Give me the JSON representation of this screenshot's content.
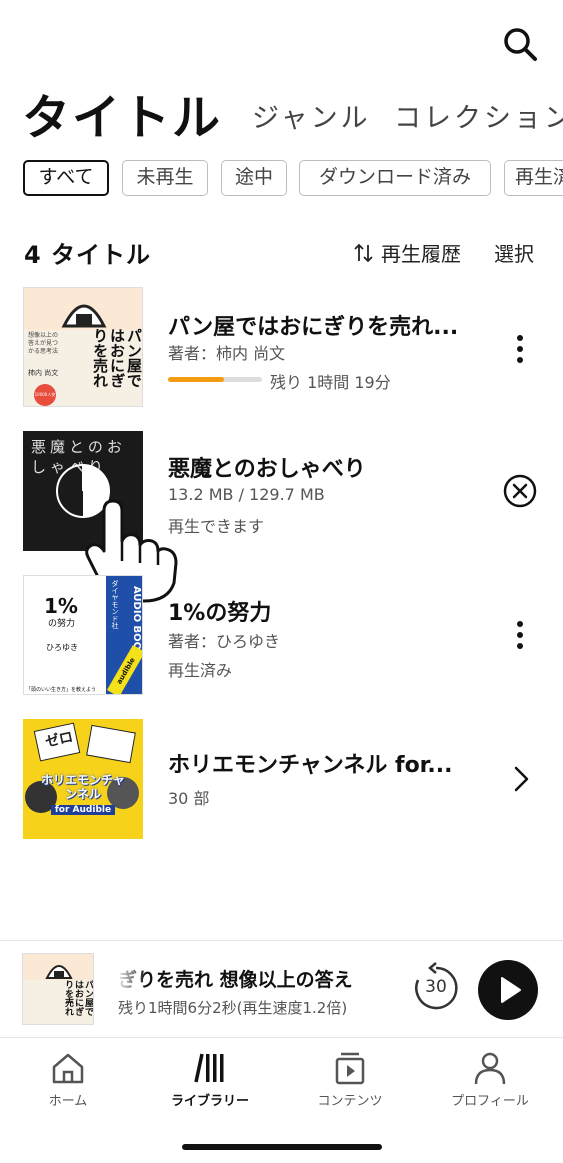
{
  "tabs": {
    "main": "タイトル",
    "genre": "ジャンル",
    "collection": "コレクション"
  },
  "filters": [
    "すべて",
    "未再生",
    "途中",
    "ダウンロード済み",
    "再生済"
  ],
  "list_header": {
    "count": "4 タイトル",
    "sort_label": "再生履歴",
    "select_label": "選択"
  },
  "items": [
    {
      "title": "パン屋ではおにぎりを売れ...",
      "line1": "著者：柿内 尚文",
      "progress_fraction": 0.6,
      "line2": "残り 1時間 19分",
      "cover_text": {
        "top": "想像以上の答えが見つかる思考法",
        "main": "パン屋ではおにぎりを売れ",
        "author": "柿内 尚文",
        "badge": "10000人突破！"
      }
    },
    {
      "title": "悪魔とのおしゃべり",
      "line1": "13.2 MB / 129.7 MB",
      "line2": "再生できます",
      "cover_text": {
        "main": "悪魔とのおしゃべり"
      }
    },
    {
      "title": "1%の努力",
      "line1": "著者：ひろゆき",
      "line2": "再生済み",
      "cover_text": {
        "main": "1%",
        "sub": "の努力",
        "author": "ひろゆき",
        "publisher": "ダイヤモンド社",
        "band": "AUDIO BOOK",
        "brand": "audible",
        "tagline": "「頭のいい生き方」を教えよう"
      }
    },
    {
      "title": "ホリエモンチャンネル for...",
      "line1": "30 部",
      "cover_text": {
        "main": "ホリエモンチャンネル",
        "sub": "for Audible",
        "mark": "ゼロ"
      }
    }
  ],
  "mini_player": {
    "title": "ぎりを売れ 想像以上の答え",
    "subtitle": "残り1時間6分2秒(再生速度1.2倍)",
    "replay_seconds": "30"
  },
  "nav": [
    {
      "label": "ホーム",
      "icon": "home-icon"
    },
    {
      "label": "ライブラリー",
      "icon": "library-icon",
      "active": true
    },
    {
      "label": "コンテンツ",
      "icon": "content-icon"
    },
    {
      "label": "プロフィール",
      "icon": "profile-icon"
    }
  ],
  "colors": {
    "accent": "#f39c12",
    "text": "#111111",
    "muted": "#555555"
  }
}
